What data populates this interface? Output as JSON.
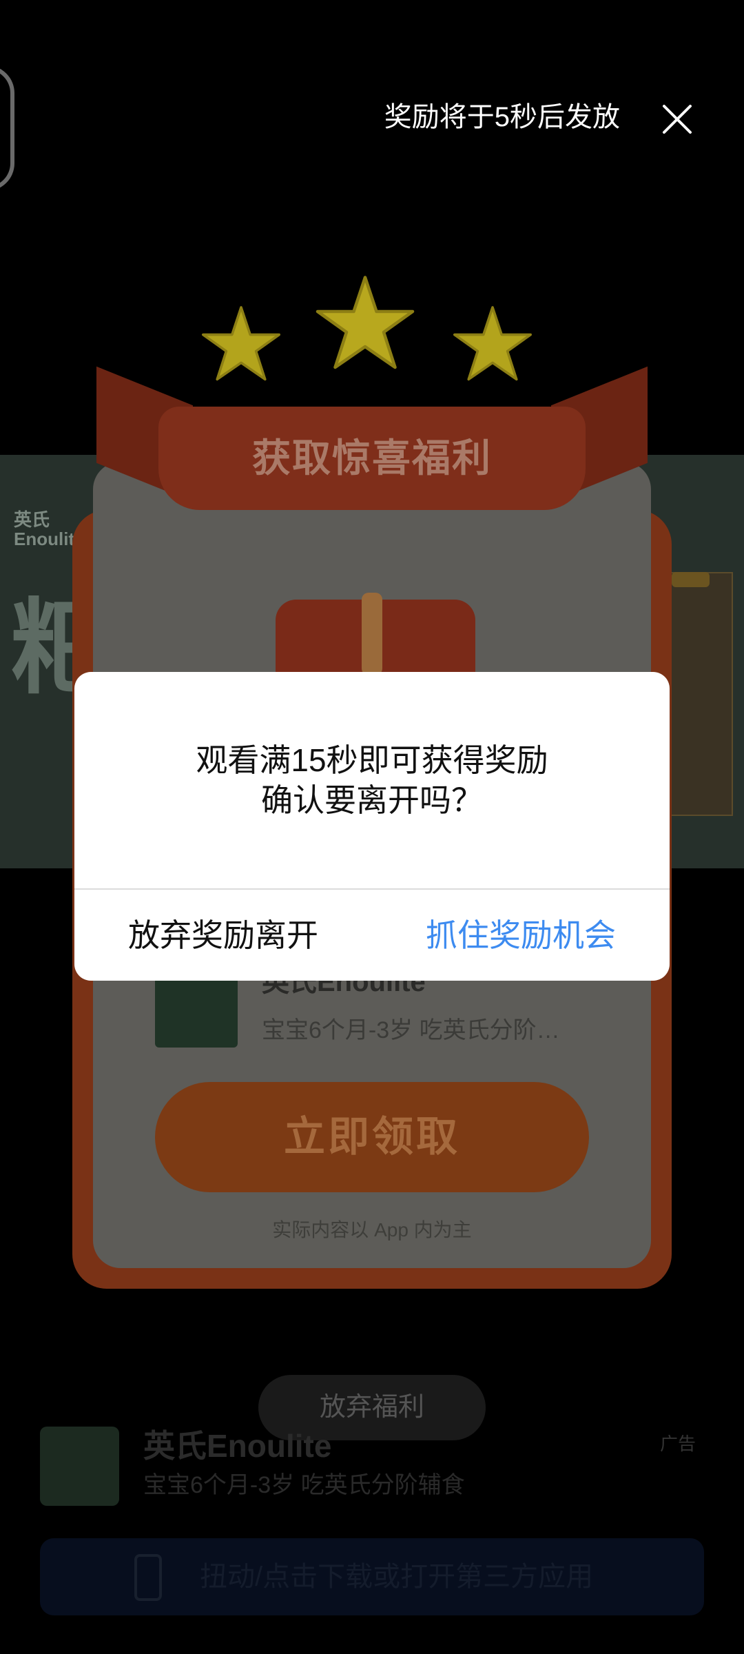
{
  "top_bar": {
    "countdown_text": "奖励将于5秒后发放",
    "close_icon": "close-icon"
  },
  "background_ad": {
    "brand_line1": "英氏",
    "brand_line2": "Enoulite",
    "big_char": "粑"
  },
  "reward_card": {
    "ribbon_title": "获取惊喜福利",
    "product": {
      "name": "英氏Enoulite",
      "description": "宝宝6个月-3岁 吃英氏分阶…"
    },
    "claim_button": "立即领取",
    "disclaimer": "实际内容以 App 内为主"
  },
  "give_up_button": "放弃福利",
  "bottom_ad": {
    "app_name": "英氏Enoulite",
    "app_desc": "宝宝6个月-3岁 吃英氏分阶辅食",
    "ad_tag": "广告",
    "cta_text": "扭动/点击下载或打开第三方应用"
  },
  "dialog": {
    "message_line1": "观看满15秒即可获得奖励",
    "message_line2": "确认要离开吗？",
    "leave_button": "放弃奖励离开",
    "stay_button": "抓住奖励机会"
  },
  "colors": {
    "overlay": "#000000",
    "dialog_bg": "#ffffff",
    "accent_blue": "#3d8bf0",
    "star_yellow": "#b3a41c"
  }
}
